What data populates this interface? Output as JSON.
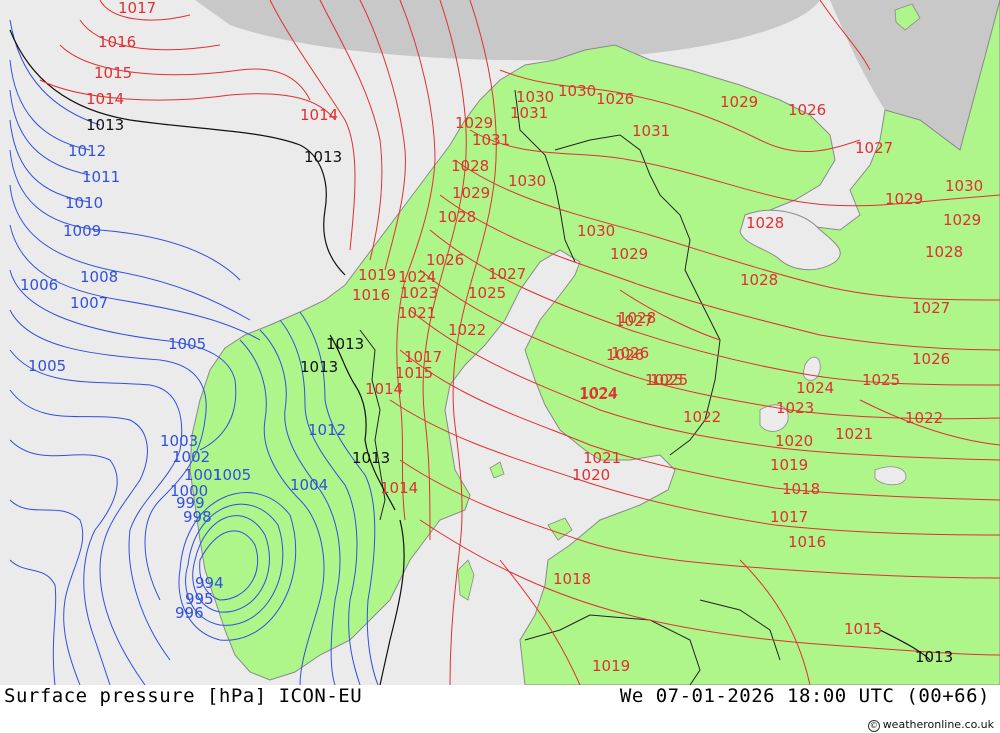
{
  "map": {
    "colors": {
      "sea": "#ebebeb",
      "land": "#aef58a",
      "land_edge": "#8a8a8a",
      "gray_region": "#c8c8c8",
      "red_isobar": "#e03030",
      "blue_isobar": "#3050e0",
      "black_isobar": "#111111"
    },
    "isobar_labels": [
      {
        "text": "1017",
        "color": "red"
      },
      {
        "text": "1016",
        "color": "red"
      },
      {
        "text": "1015",
        "color": "red"
      },
      {
        "text": "1014",
        "color": "red"
      },
      {
        "text": "1013",
        "color": "black"
      },
      {
        "text": "1012",
        "color": "blue"
      },
      {
        "text": "1011",
        "color": "blue"
      },
      {
        "text": "1010",
        "color": "blue"
      },
      {
        "text": "1009",
        "color": "blue"
      },
      {
        "text": "1008",
        "color": "blue"
      },
      {
        "text": "1007",
        "color": "blue"
      },
      {
        "text": "1006",
        "color": "blue"
      },
      {
        "text": "1005",
        "color": "blue"
      },
      {
        "text": "1005",
        "color": "blue"
      },
      {
        "text": "1014",
        "color": "red"
      },
      {
        "text": "1013",
        "color": "black"
      },
      {
        "text": "1013",
        "color": "black"
      },
      {
        "text": "1013",
        "color": "black"
      },
      {
        "text": "1013",
        "color": "black"
      },
      {
        "text": "1012",
        "color": "blue"
      },
      {
        "text": "1004",
        "color": "blue"
      },
      {
        "text": "1003",
        "color": "blue"
      },
      {
        "text": "1002",
        "color": "blue"
      },
      {
        "text": "1001",
        "color": "blue"
      },
      {
        "text": "1000",
        "color": "blue"
      },
      {
        "text": "999",
        "color": "blue"
      },
      {
        "text": "998",
        "color": "blue"
      },
      {
        "text": "994",
        "color": "blue"
      },
      {
        "text": "995",
        "color": "blue"
      },
      {
        "text": "996",
        "color": "blue"
      },
      {
        "text": "1005",
        "color": "blue"
      },
      {
        "text": "1014",
        "color": "red"
      },
      {
        "text": "1014",
        "color": "red"
      },
      {
        "text": "1015",
        "color": "red"
      },
      {
        "text": "1016",
        "color": "red"
      },
      {
        "text": "1017",
        "color": "red"
      },
      {
        "text": "1019",
        "color": "red"
      },
      {
        "text": "1021",
        "color": "red"
      },
      {
        "text": "1022",
        "color": "red"
      },
      {
        "text": "1023",
        "color": "red"
      },
      {
        "text": "1024",
        "color": "red"
      },
      {
        "text": "1025",
        "color": "red"
      },
      {
        "text": "1026",
        "color": "red"
      },
      {
        "text": "1027",
        "color": "red"
      },
      {
        "text": "1028",
        "color": "red"
      },
      {
        "text": "1029",
        "color": "red"
      },
      {
        "text": "1030",
        "color": "red"
      },
      {
        "text": "1031",
        "color": "red"
      },
      {
        "text": "1030",
        "color": "red"
      },
      {
        "text": "1031",
        "color": "red"
      },
      {
        "text": "1029",
        "color": "red"
      },
      {
        "text": "1028",
        "color": "red"
      },
      {
        "text": "1026",
        "color": "red"
      },
      {
        "text": "1030",
        "color": "red"
      },
      {
        "text": "1031",
        "color": "red"
      },
      {
        "text": "1030",
        "color": "red"
      },
      {
        "text": "1029",
        "color": "red"
      },
      {
        "text": "1028",
        "color": "red"
      },
      {
        "text": "1026",
        "color": "red"
      },
      {
        "text": "1024",
        "color": "red"
      },
      {
        "text": "1025",
        "color": "red"
      },
      {
        "text": "1026",
        "color": "red"
      },
      {
        "text": "1027",
        "color": "red"
      },
      {
        "text": "1028",
        "color": "red"
      },
      {
        "text": "1029",
        "color": "red"
      },
      {
        "text": "1030",
        "color": "red"
      },
      {
        "text": "1029",
        "color": "red"
      },
      {
        "text": "1028",
        "color": "red"
      },
      {
        "text": "1027",
        "color": "red"
      },
      {
        "text": "1026",
        "color": "red"
      },
      {
        "text": "1025",
        "color": "red"
      },
      {
        "text": "1024",
        "color": "red"
      },
      {
        "text": "1023",
        "color": "red"
      },
      {
        "text": "1022",
        "color": "red"
      },
      {
        "text": "1021",
        "color": "red"
      },
      {
        "text": "1020",
        "color": "red"
      },
      {
        "text": "1019",
        "color": "red"
      },
      {
        "text": "1018",
        "color": "red"
      },
      {
        "text": "1017",
        "color": "red"
      },
      {
        "text": "1016",
        "color": "red"
      },
      {
        "text": "1015",
        "color": "red"
      },
      {
        "text": "1013",
        "color": "black"
      },
      {
        "text": "1018",
        "color": "red"
      },
      {
        "text": "1019",
        "color": "red"
      },
      {
        "text": "1020",
        "color": "red"
      },
      {
        "text": "1021",
        "color": "red"
      },
      {
        "text": "1022",
        "color": "red"
      },
      {
        "text": "1024",
        "color": "red"
      },
      {
        "text": "1025",
        "color": "red"
      },
      {
        "text": "1026",
        "color": "red"
      },
      {
        "text": "1027",
        "color": "red"
      },
      {
        "text": "1028",
        "color": "red"
      },
      {
        "text": "1029",
        "color": "red"
      },
      {
        "text": "1030",
        "color": "red"
      },
      {
        "text": "1025",
        "color": "red"
      },
      {
        "text": "1027",
        "color": "red"
      }
    ]
  },
  "footer": {
    "title": "Surface pressure [hPa] ICON-EU",
    "datetime": "We 07-01-2026 18:00 UTC (00+66)",
    "credit": "weatheronline.co.uk"
  }
}
